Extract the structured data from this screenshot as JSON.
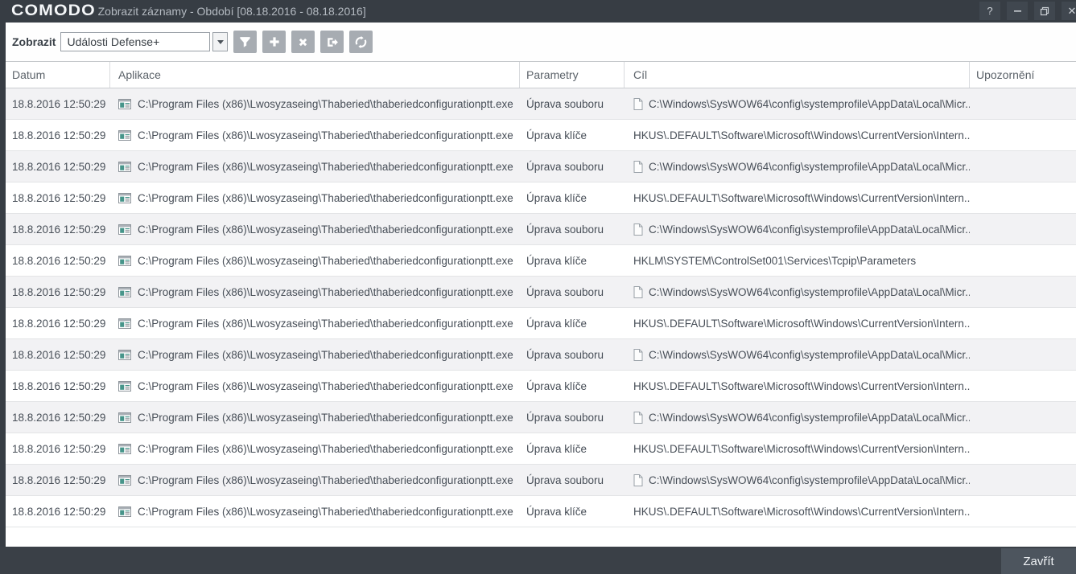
{
  "titlebar": {
    "logo": "COMODO",
    "title": "Zobrazit záznamy - Období [08.18.2016 - 08.18.2016]",
    "help_glyph": "?",
    "close_glyph": "✕"
  },
  "toolbar": {
    "view_label": "Zobrazit",
    "view_value": "Události Defense+",
    "buttons": [
      "filter",
      "add",
      "delete",
      "export",
      "refresh"
    ]
  },
  "table": {
    "columns": [
      "Datum",
      "Aplikace",
      "Parametry",
      "Cíl",
      "Upozornění"
    ],
    "rows": [
      {
        "date": "18.8.2016 12:50:29",
        "application": "C:\\Program Files (x86)\\Lwosyzaseing\\Thaberied\\thaberiedconfigurationptt.exe",
        "parameters": "Úprava souboru",
        "target": "C:\\Windows\\SysWOW64\\config\\systemprofile\\AppData\\Local\\Micr...",
        "target_icon": true
      },
      {
        "date": "18.8.2016 12:50:29",
        "application": "C:\\Program Files (x86)\\Lwosyzaseing\\Thaberied\\thaberiedconfigurationptt.exe",
        "parameters": "Úprava klíče",
        "target": "HKUS\\.DEFAULT\\Software\\Microsoft\\Windows\\CurrentVersion\\Intern...",
        "target_icon": false
      },
      {
        "date": "18.8.2016 12:50:29",
        "application": "C:\\Program Files (x86)\\Lwosyzaseing\\Thaberied\\thaberiedconfigurationptt.exe",
        "parameters": "Úprava souboru",
        "target": "C:\\Windows\\SysWOW64\\config\\systemprofile\\AppData\\Local\\Micr...",
        "target_icon": true
      },
      {
        "date": "18.8.2016 12:50:29",
        "application": "C:\\Program Files (x86)\\Lwosyzaseing\\Thaberied\\thaberiedconfigurationptt.exe",
        "parameters": "Úprava klíče",
        "target": "HKUS\\.DEFAULT\\Software\\Microsoft\\Windows\\CurrentVersion\\Intern...",
        "target_icon": false
      },
      {
        "date": "18.8.2016 12:50:29",
        "application": "C:\\Program Files (x86)\\Lwosyzaseing\\Thaberied\\thaberiedconfigurationptt.exe",
        "parameters": "Úprava souboru",
        "target": "C:\\Windows\\SysWOW64\\config\\systemprofile\\AppData\\Local\\Micr...",
        "target_icon": true
      },
      {
        "date": "18.8.2016 12:50:29",
        "application": "C:\\Program Files (x86)\\Lwosyzaseing\\Thaberied\\thaberiedconfigurationptt.exe",
        "parameters": "Úprava klíče",
        "target": "HKLM\\SYSTEM\\ControlSet001\\Services\\Tcpip\\Parameters",
        "target_icon": false
      },
      {
        "date": "18.8.2016 12:50:29",
        "application": "C:\\Program Files (x86)\\Lwosyzaseing\\Thaberied\\thaberiedconfigurationptt.exe",
        "parameters": "Úprava souboru",
        "target": "C:\\Windows\\SysWOW64\\config\\systemprofile\\AppData\\Local\\Micr...",
        "target_icon": true
      },
      {
        "date": "18.8.2016 12:50:29",
        "application": "C:\\Program Files (x86)\\Lwosyzaseing\\Thaberied\\thaberiedconfigurationptt.exe",
        "parameters": "Úprava klíče",
        "target": "HKUS\\.DEFAULT\\Software\\Microsoft\\Windows\\CurrentVersion\\Intern...",
        "target_icon": false
      },
      {
        "date": "18.8.2016 12:50:29",
        "application": "C:\\Program Files (x86)\\Lwosyzaseing\\Thaberied\\thaberiedconfigurationptt.exe",
        "parameters": "Úprava souboru",
        "target": "C:\\Windows\\SysWOW64\\config\\systemprofile\\AppData\\Local\\Micr...",
        "target_icon": true
      },
      {
        "date": "18.8.2016 12:50:29",
        "application": "C:\\Program Files (x86)\\Lwosyzaseing\\Thaberied\\thaberiedconfigurationptt.exe",
        "parameters": "Úprava klíče",
        "target": "HKUS\\.DEFAULT\\Software\\Microsoft\\Windows\\CurrentVersion\\Intern...",
        "target_icon": false
      },
      {
        "date": "18.8.2016 12:50:29",
        "application": "C:\\Program Files (x86)\\Lwosyzaseing\\Thaberied\\thaberiedconfigurationptt.exe",
        "parameters": "Úprava souboru",
        "target": "C:\\Windows\\SysWOW64\\config\\systemprofile\\AppData\\Local\\Micr...",
        "target_icon": true
      },
      {
        "date": "18.8.2016 12:50:29",
        "application": "C:\\Program Files (x86)\\Lwosyzaseing\\Thaberied\\thaberiedconfigurationptt.exe",
        "parameters": "Úprava klíče",
        "target": "HKUS\\.DEFAULT\\Software\\Microsoft\\Windows\\CurrentVersion\\Intern...",
        "target_icon": false
      },
      {
        "date": "18.8.2016 12:50:29",
        "application": "C:\\Program Files (x86)\\Lwosyzaseing\\Thaberied\\thaberiedconfigurationptt.exe",
        "parameters": "Úprava souboru",
        "target": "C:\\Windows\\SysWOW64\\config\\systemprofile\\AppData\\Local\\Micr...",
        "target_icon": true
      },
      {
        "date": "18.8.2016 12:50:29",
        "application": "C:\\Program Files (x86)\\Lwosyzaseing\\Thaberied\\thaberiedconfigurationptt.exe",
        "parameters": "Úprava klíče",
        "target": "HKUS\\.DEFAULT\\Software\\Microsoft\\Windows\\CurrentVersion\\Intern...",
        "target_icon": false
      }
    ]
  },
  "footer": {
    "close_label": "Zavřít"
  },
  "colors": {
    "titlebar": "#373d44",
    "footer": "#3a4047",
    "toolbar_button": "#a7acb2",
    "row_alt": "#f2f2f4",
    "app_icon_teal": "#47958a"
  }
}
